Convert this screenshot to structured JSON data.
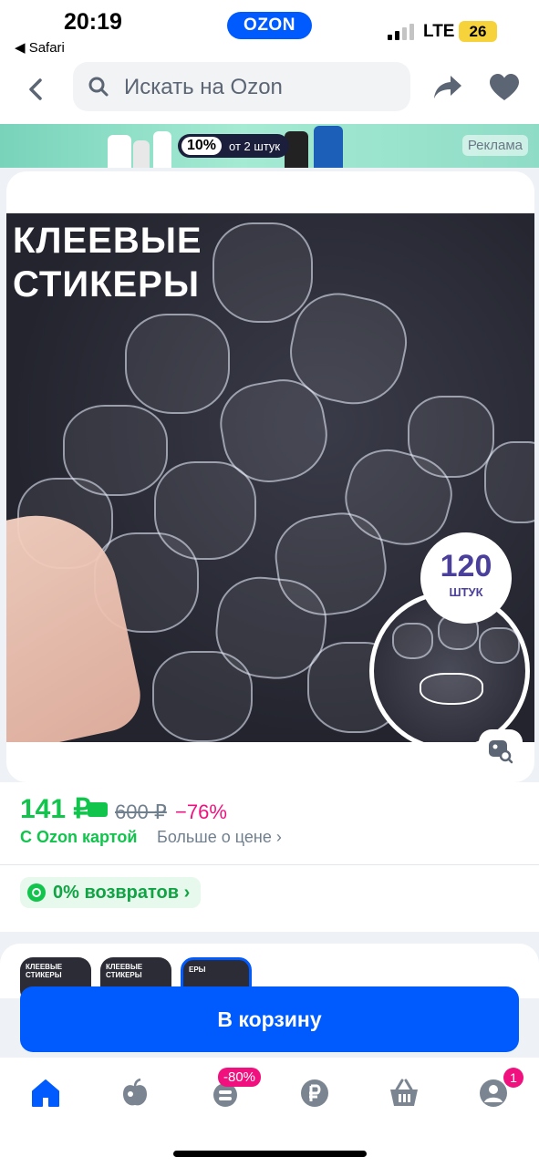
{
  "status_bar": {
    "time": "20:19",
    "back_app": "◀ Safari",
    "app_badge": "OZON",
    "network": "LTE",
    "battery": "26"
  },
  "header": {
    "search_placeholder": "Искать на Ozon",
    "icons": [
      "back-arrow-icon",
      "search-icon",
      "share-icon",
      "heart-icon"
    ]
  },
  "banner": {
    "promo_percent": "10%",
    "promo_text": "от 2 штук",
    "ad_label": "Реклама"
  },
  "product": {
    "photo_title": "КЛЕЕВЫЕ СТИКЕРЫ",
    "count_number": "120",
    "count_unit": "ШТУК"
  },
  "price": {
    "current": "141 ₽",
    "old": "600 ₽",
    "discount": "−76%",
    "card_label": "С Ozon картой",
    "more_link": "Больше о цене  ›",
    "returns": "0% возвратов  ›"
  },
  "thumbs": [
    {
      "label": "КЛЕЕВЫЕ СТИКЕРЫ"
    },
    {
      "label": "КЛЕЕВЫЕ СТИКЕРЫ"
    },
    {
      "label": "ЕРЫ"
    }
  ],
  "cart_button": "В корзину",
  "tabbar": {
    "promo_tag": "-80%",
    "notification_count": "1",
    "icons": [
      "home-icon",
      "apple-icon",
      "sale-icon",
      "ruble-icon",
      "basket-icon",
      "profile-icon"
    ]
  },
  "colors": {
    "brand_blue": "#005bff",
    "price_green": "#10c44c",
    "accent_pink": "#f1117e"
  }
}
